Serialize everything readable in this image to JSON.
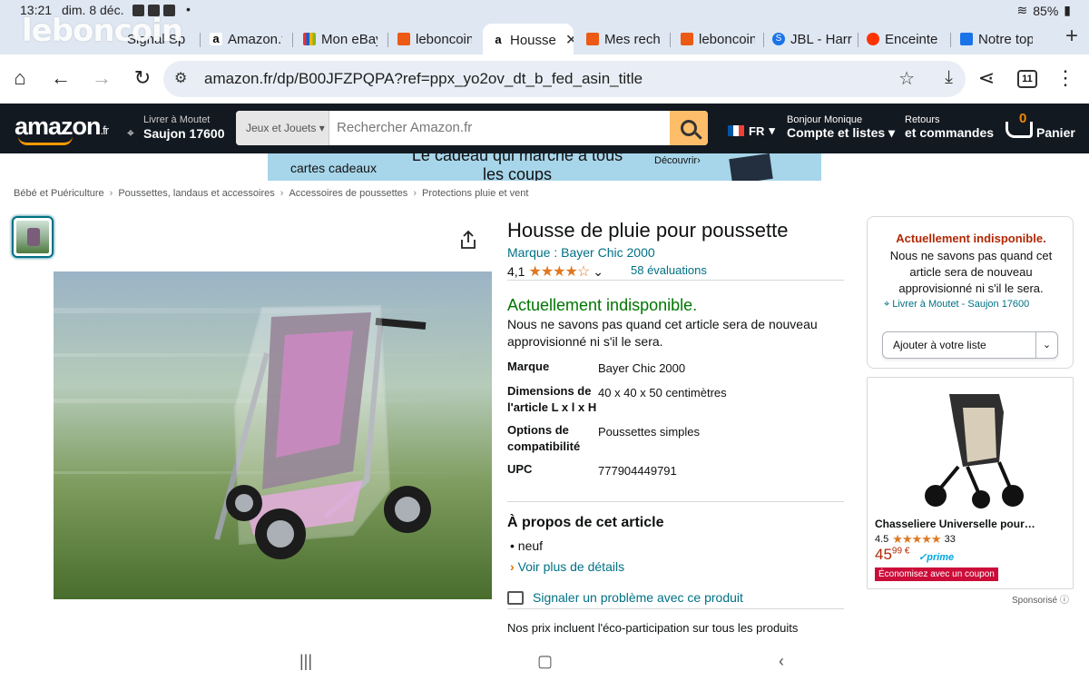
{
  "status": {
    "time": "13:21",
    "date": "dim. 8 déc.",
    "dot": "•",
    "battery": "85%"
  },
  "watermark": "leboncoin",
  "tabs": [
    {
      "label": "Signal Sp",
      "favicon": "signal-icon"
    },
    {
      "label": "Amazon.f",
      "favicon": "amazon-icon"
    },
    {
      "label": "Mon eBay",
      "favicon": "ebay-icon"
    },
    {
      "label": "leboncoin",
      "favicon": "leboncoin-icon"
    },
    {
      "label": "Housse",
      "favicon": "amazon-icon",
      "active": true
    },
    {
      "label": "Mes rech",
      "favicon": "leboncoin-icon"
    },
    {
      "label": "leboncoin",
      "favicon": "leboncoin-icon"
    },
    {
      "label": "JBL - Harr",
      "favicon": "s-icon"
    },
    {
      "label": "Enceinte",
      "favicon": "jbl-icon"
    },
    {
      "label": "Notre top",
      "favicon": "n-icon"
    }
  ],
  "new_tab": "+",
  "toolbar": {
    "url": "amazon.fr/dp/B00JFZPQPA?ref=ppx_yo2ov_dt_b_fed_asin_title",
    "tab_count": "11"
  },
  "header": {
    "logo": "amazon",
    "logo_tld": ".fr",
    "deliver_line1": "Livrer à Moutet",
    "deliver_line2": "Saujon 17600",
    "search_category": "Jeux et Jouets",
    "search_placeholder": "Rechercher Amazon.fr",
    "language": "FR",
    "account_line1": "Bonjour Monique",
    "account_line2": "Compte et listes",
    "returns_line1": "Retours",
    "returns_line2": "et commandes",
    "cart_count": "0",
    "cart_label": "Panier"
  },
  "banner": {
    "left": "cartes cadeaux",
    "center": "Le cadeau qui marche à tous les coups",
    "cta": "Découvrir›"
  },
  "breadcrumb": [
    "Bébé et Puériculture",
    "Poussettes, landaus et accessoires",
    "Accessoires de poussettes",
    "Protections pluie et vent"
  ],
  "product": {
    "title": "Housse de pluie pour poussette",
    "brand_link": "Marque : Bayer Chic 2000",
    "rating_value": "4,1",
    "rating": 4.1,
    "stars": "★★★★☆",
    "reviews": "58 évaluations",
    "availability": "Actuellement indisponible.",
    "restock": "Nous ne savons pas quand cet article sera de nouveau approvisionné ni s'il le sera.",
    "specs": [
      {
        "key": "Marque",
        "value": "Bayer Chic 2000"
      },
      {
        "key": "Dimensions de l'article L x l x H",
        "value": "40 x 40 x 50 centimètres"
      },
      {
        "key": "Options de compatibilité",
        "value": "Poussettes simples"
      },
      {
        "key": "UPC",
        "value": "777904449791"
      }
    ],
    "about_title": "À propos de cet article",
    "bullets": [
      "neuf"
    ],
    "see_more": "Voir plus de détails",
    "report": "Signaler un problème avec ce produit",
    "eco_note": "Nos prix incluent l'éco-participation sur tous les produits"
  },
  "buybox": {
    "unavailable": "Actuellement indisponible.",
    "message": "Nous ne savons pas quand cet article sera de nouveau approvisionné ni s'il le sera.",
    "deliver": "Livrer à Moutet - Saujon 17600",
    "add_to_list": "Ajouter à votre liste"
  },
  "ad": {
    "name": "Chasseliere Universelle pour…",
    "rating_value": "4.5",
    "rating": 4.5,
    "stars": "★★★★★",
    "rating_count": "33",
    "price_whole": "45",
    "price_fraction": "99 €",
    "prime": "prime",
    "coupon": "Économisez avec un coupon",
    "sponsored": "Sponsorisé"
  },
  "colors": {
    "amazon_dark": "#131921",
    "search_button": "#febd69",
    "link": "#007185",
    "in_stock_green": "#007600",
    "price_red": "#b12704",
    "star_orange": "#de7921"
  }
}
